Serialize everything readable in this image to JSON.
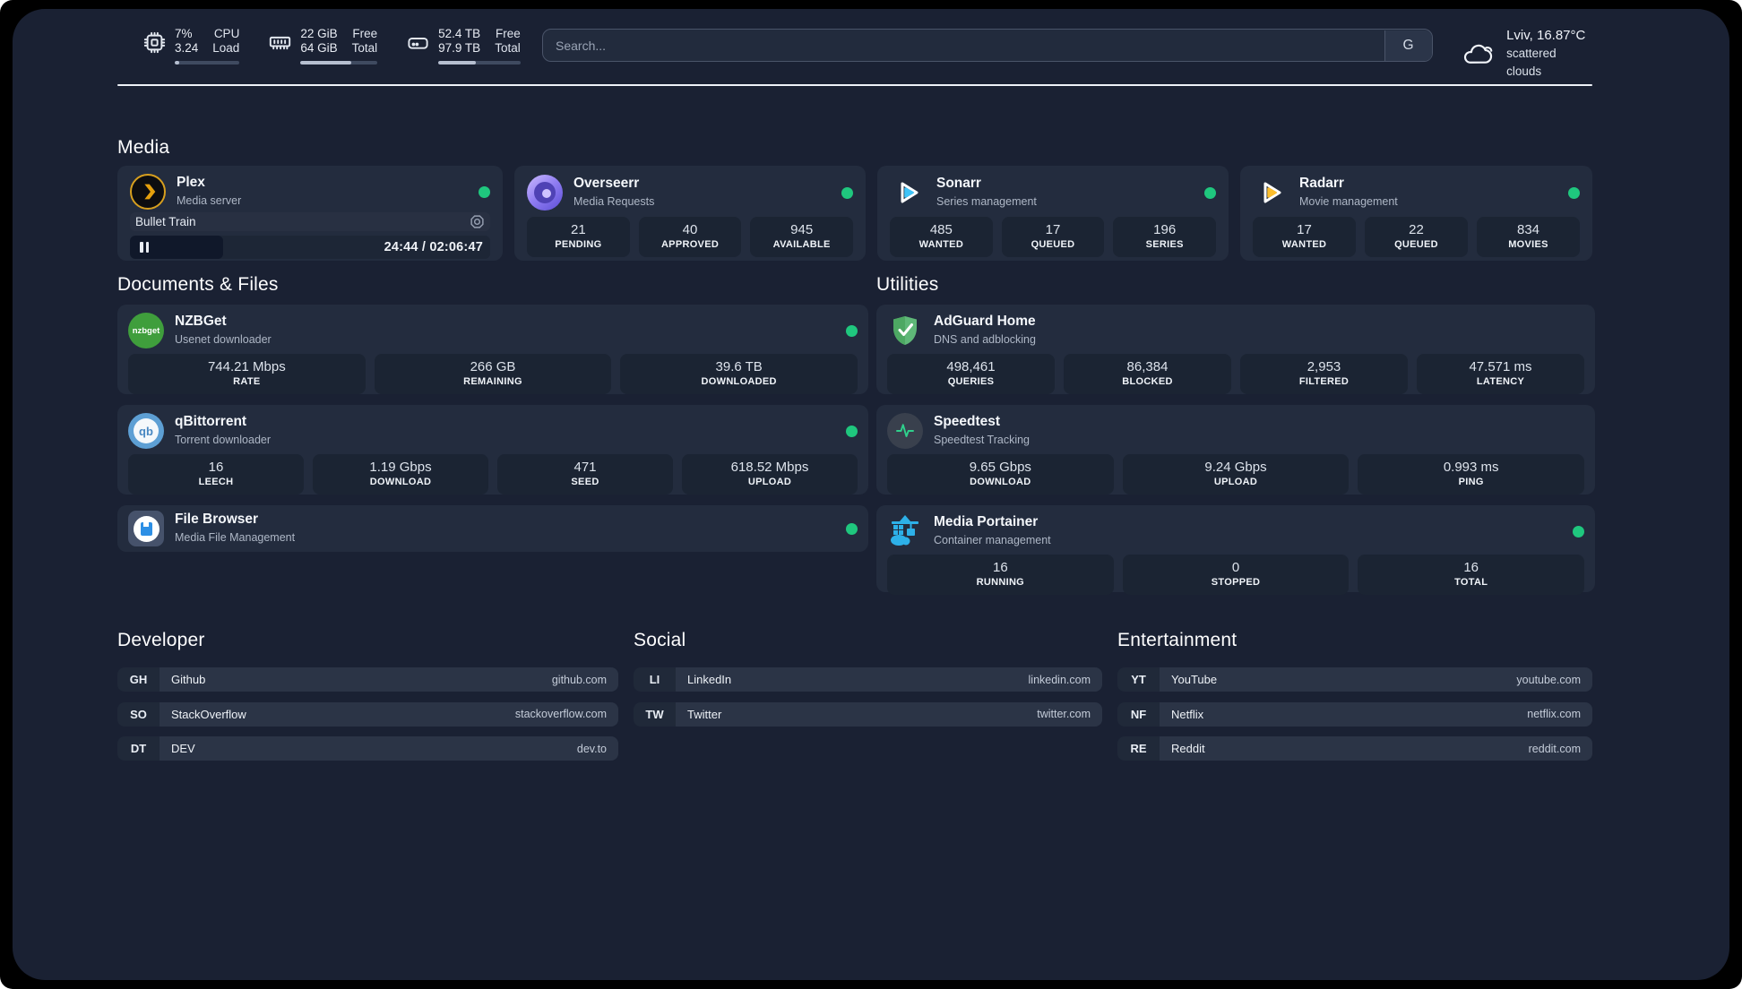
{
  "colors": {
    "page_bg": "#1a2133",
    "card_bg": "#232c3e",
    "tile_bg": "#1b2433",
    "status_online": "#1fc77e",
    "plex_accent": "#e5a00d",
    "sonarr_accent": "#3fc3f7",
    "radarr_accent": "#fcbe2d",
    "adguard_accent": "#5fb878",
    "portainer_accent": "#2db0e8",
    "speedtest_accent": "#2fd08c"
  },
  "header": {
    "metrics": {
      "cpu": {
        "value_top": "7%",
        "value_bottom": "3.24",
        "label_top": "CPU",
        "label_bottom": "Load",
        "progress": 7
      },
      "ram": {
        "value_top": "22 GiB",
        "value_bottom": "64 GiB",
        "label_top": "Free",
        "label_bottom": "Total",
        "progress": 66
      },
      "disk": {
        "value_top": "52.4 TB",
        "value_bottom": "97.9 TB",
        "label_top": "Free",
        "label_bottom": "Total",
        "progress": 46
      }
    },
    "search": {
      "placeholder": "Search...",
      "button_label": "G"
    },
    "weather": {
      "location": "Lviv, 16.87°C",
      "condition": "scattered clouds"
    }
  },
  "sections": {
    "media": {
      "title": "Media",
      "plex": {
        "name": "Plex",
        "description": "Media server",
        "status": "online",
        "now_playing": {
          "title": "Bullet Train",
          "state": "paused",
          "time_display": "24:44 / 02:06:47"
        }
      },
      "overseerr": {
        "name": "Overseerr",
        "description": "Media Requests",
        "status": "online",
        "stats": [
          {
            "value": "21",
            "label": "PENDING"
          },
          {
            "value": "40",
            "label": "APPROVED"
          },
          {
            "value": "945",
            "label": "AVAILABLE"
          }
        ]
      },
      "sonarr": {
        "name": "Sonarr",
        "description": "Series management",
        "status": "online",
        "stats": [
          {
            "value": "485",
            "label": "WANTED"
          },
          {
            "value": "17",
            "label": "QUEUED"
          },
          {
            "value": "196",
            "label": "SERIES"
          }
        ]
      },
      "radarr": {
        "name": "Radarr",
        "description": "Movie management",
        "status": "online",
        "stats": [
          {
            "value": "17",
            "label": "WANTED"
          },
          {
            "value": "22",
            "label": "QUEUED"
          },
          {
            "value": "834",
            "label": "MOVIES"
          }
        ]
      }
    },
    "documents": {
      "title": "Documents & Files",
      "nzbget": {
        "name": "NZBGet",
        "description": "Usenet downloader",
        "status": "online",
        "icon_text": "nzbget",
        "stats": [
          {
            "value": "744.21 Mbps",
            "label": "RATE"
          },
          {
            "value": "266 GB",
            "label": "REMAINING"
          },
          {
            "value": "39.6 TB",
            "label": "DOWNLOADED"
          }
        ]
      },
      "qbittorrent": {
        "name": "qBittorrent",
        "description": "Torrent downloader",
        "status": "online",
        "icon_text": "qb",
        "stats": [
          {
            "value": "16",
            "label": "LEECH"
          },
          {
            "value": "1.19 Gbps",
            "label": "DOWNLOAD"
          },
          {
            "value": "471",
            "label": "SEED"
          },
          {
            "value": "618.52 Mbps",
            "label": "UPLOAD"
          }
        ]
      },
      "filebrowser": {
        "name": "File Browser",
        "description": "Media File Management",
        "status": "online"
      }
    },
    "utilities": {
      "title": "Utilities",
      "adguard": {
        "name": "AdGuard Home",
        "description": "DNS and adblocking",
        "stats": [
          {
            "value": "498,461",
            "label": "QUERIES"
          },
          {
            "value": "86,384",
            "label": "BLOCKED"
          },
          {
            "value": "2,953",
            "label": "FILTERED"
          },
          {
            "value": "47.571 ms",
            "label": "LATENCY"
          }
        ]
      },
      "speedtest": {
        "name": "Speedtest",
        "description": "Speedtest Tracking",
        "stats": [
          {
            "value": "9.65 Gbps",
            "label": "DOWNLOAD"
          },
          {
            "value": "9.24 Gbps",
            "label": "UPLOAD"
          },
          {
            "value": "0.993 ms",
            "label": "PING"
          }
        ]
      },
      "portainer": {
        "name": "Media Portainer",
        "description": "Container management",
        "status": "online",
        "stats": [
          {
            "value": "16",
            "label": "RUNNING"
          },
          {
            "value": "0",
            "label": "STOPPED"
          },
          {
            "value": "16",
            "label": "TOTAL"
          }
        ]
      }
    },
    "developer": {
      "title": "Developer",
      "links": [
        {
          "tag": "GH",
          "name": "Github",
          "url": "github.com"
        },
        {
          "tag": "SO",
          "name": "StackOverflow",
          "url": "stackoverflow.com"
        },
        {
          "tag": "DT",
          "name": "DEV",
          "url": "dev.to"
        }
      ]
    },
    "social": {
      "title": "Social",
      "links": [
        {
          "tag": "LI",
          "name": "LinkedIn",
          "url": "linkedin.com"
        },
        {
          "tag": "TW",
          "name": "Twitter",
          "url": "twitter.com"
        }
      ]
    },
    "entertainment": {
      "title": "Entertainment",
      "links": [
        {
          "tag": "YT",
          "name": "YouTube",
          "url": "youtube.com"
        },
        {
          "tag": "NF",
          "name": "Netflix",
          "url": "netflix.com"
        },
        {
          "tag": "RE",
          "name": "Reddit",
          "url": "reddit.com"
        }
      ]
    }
  }
}
